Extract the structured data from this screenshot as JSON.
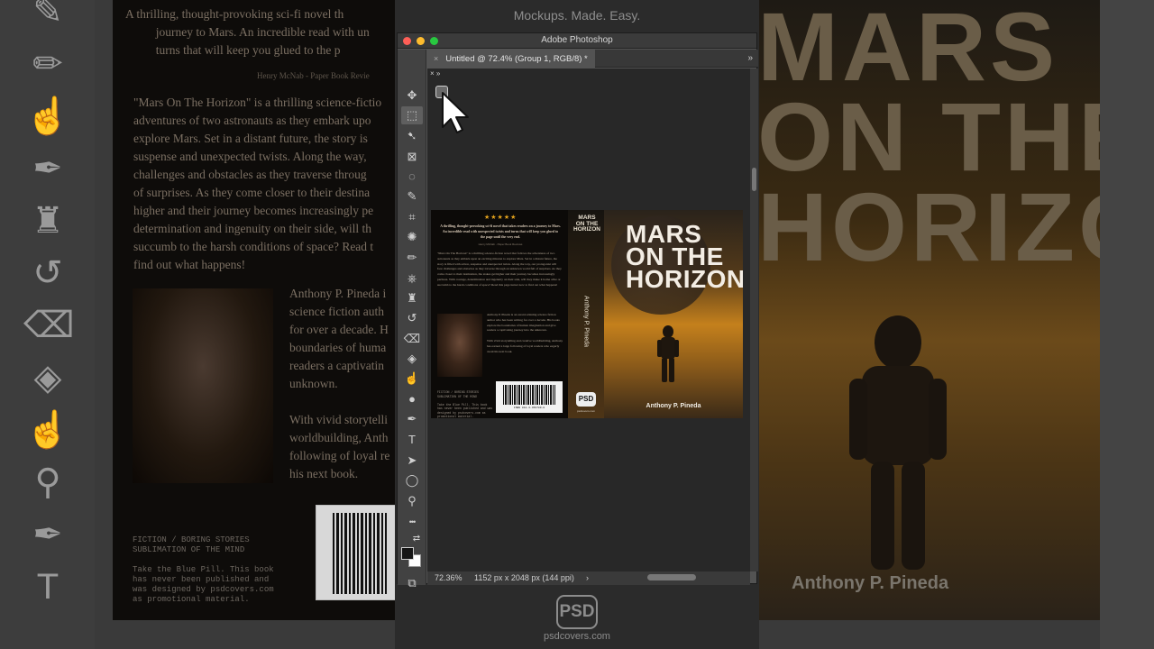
{
  "background": {
    "left": {
      "quote": "A thrilling, thought-provoking sci-fi novel th\n          journey to Mars. An incredible read with un\n          turns that will keep you glued to the p",
      "quote_attr": "Henry McNab - Paper Book Revie",
      "blurb": "\"Mars On The Horizon\" is a thrilling science-fictio\nadventures of two astronauts as they embark upo\nexplore Mars. Set in a distant future, the story is\nsuspense and unexpected twists. Along the way,\nchallenges and obstacles as they traverse throug\nof surprises. As they come closer to their destina\nhigher and their journey becomes increasingly pe\ndetermination and ingenuity on their side, will th\nsuccumb to the harsh conditions of space? Read t\nfind out what happens!",
      "author_bio": "Anthony P. Pineda i\nscience fiction auth\nfor over a decade. H\nboundaries of huma\nreaders a captivatin\nunknown.\n\nWith vivid storytelli\nworldbuilding, Anth\nfollowing of loyal re\nhis next book.",
      "genre": "FICTION / BORING STORIES\nSUBLIMATION OF THE MIND\n\nTake the Blue Pill. This book\nhas never been published and\nwas designed by psdcovers.com\nas promotional material."
    },
    "right": {
      "title": "MARS\nON THE\nHORIZON",
      "author": "Anthony P. Pineda"
    }
  },
  "center": {
    "tagline": "Mockups. Made. Easy.",
    "footer_logo": "PSD",
    "footer_url": "psdcovers.com"
  },
  "window": {
    "title": "Adobe Photoshop",
    "tab_label": "Untitled @ 72.4% (Group 1, RGB/8) *",
    "tab_close": "×",
    "collapse": "»",
    "panel_controls": "× »",
    "status": {
      "zoom": "72.36%",
      "dimensions": "1152 px x 2048 px (144 ppi)",
      "arrow": "›"
    }
  },
  "book": {
    "stars": "★★★★★",
    "quote": "A thrilling, thought-provoking sci-fi novel that takes readers on a journey to Mars. An incredible read with unexpected twists and turns that will keep you glued to the page until the very end.",
    "quote_attr": "Henry McNab - Paper Book Reviews",
    "blurb": "\"Mars On The Horizon\" is a thrilling science-fiction novel that follows the adventures of two astronauts as they embark upon an exciting mission to explore Mars. Set in a distant future, the story is filled with action, suspense and unexpected twists. Along the way, our protagonist will face challenges and obstacles as they traverse through an unknown world full of surprises. As they come closer to their destination, the stakes get higher and their journey becomes increasingly perilous. With courage, determination and ingenuity on their side, will they make it home alive or succumb to the harsh conditions of space? Read this page turner now to find out what happens!",
    "author_bio": "Anthony P. Pineda is an award-winning science fiction author who has been writing for over a decade. His books explore the boundaries of human imagination and give readers a captivating journey into the unknown.\n\nWith vivid storytelling and creative worldbuilding, Anthony has earned a large following of loyal readers who eagerly await his next book.",
    "genre": "FICTION / BORING STORIES SUBLIMATION OF THE MIND\n\nTake the Blue Pill. This book has never been published and was designed by psdcovers.com as promotional material.",
    "isbn": "ISBN 012-3-456789-0",
    "spine_title": "MARS\nON THE\nHORIZON",
    "spine_author": "Anthony P. Pineda",
    "spine_logo": "PSD",
    "spine_url": "psdcovers.com",
    "front_title": "MARS\nON THE\nHORIZON",
    "front_author": "Anthony P. Pineda"
  },
  "tools": [
    {
      "name": "move-tool-icon",
      "glyph": "✥"
    },
    {
      "name": "marquee-tool-icon",
      "glyph": "⬚"
    },
    {
      "name": "lasso-tool-icon",
      "glyph": "➷"
    },
    {
      "name": "frame-tool-icon",
      "glyph": "⊠"
    },
    {
      "name": "quick-select-tool-icon",
      "glyph": "◌"
    },
    {
      "name": "eyedropper-tool-icon",
      "glyph": "✎"
    },
    {
      "name": "crop-tool-icon",
      "glyph": "⌗"
    },
    {
      "name": "patch-tool-icon",
      "glyph": "✺"
    },
    {
      "name": "brush-tool-icon",
      "glyph": "✏"
    },
    {
      "name": "clone-stamp-tool-icon",
      "glyph": "⎈"
    },
    {
      "name": "stamp-tool-icon",
      "glyph": "♜"
    },
    {
      "name": "history-brush-tool-icon",
      "glyph": "↺"
    },
    {
      "name": "eraser-tool-icon",
      "glyph": "⌫"
    },
    {
      "name": "paint-bucket-tool-icon",
      "glyph": "◈"
    },
    {
      "name": "smudge-tool-icon",
      "glyph": "☝"
    },
    {
      "name": "dodge-tool-icon",
      "glyph": "●"
    },
    {
      "name": "pen-tool-icon",
      "glyph": "✒"
    },
    {
      "name": "type-tool-icon",
      "glyph": "T"
    },
    {
      "name": "path-select-tool-icon",
      "glyph": "➤"
    },
    {
      "name": "ellipse-tool-icon",
      "glyph": "◯"
    },
    {
      "name": "zoom-tool-icon",
      "glyph": "⚲"
    },
    {
      "name": "more-tools-icon",
      "glyph": "•••"
    },
    {
      "name": "reset-colors-icon",
      "glyph": "⇄"
    },
    {
      "name": "screen-mode-icon",
      "glyph": "⧉"
    }
  ],
  "bg_tools": [
    {
      "name": "bg-magic-wand-icon",
      "glyph": "✎"
    },
    {
      "name": "bg-brush-icon",
      "glyph": "✏"
    },
    {
      "name": "bg-hand-icon",
      "glyph": "☝"
    },
    {
      "name": "bg-eyedropper-icon",
      "glyph": "✒"
    },
    {
      "name": "bg-stamp-icon",
      "glyph": "♜"
    },
    {
      "name": "bg-history-icon",
      "glyph": "↺"
    },
    {
      "name": "bg-eraser-icon",
      "glyph": "⌫"
    },
    {
      "name": "bg-bucket-icon",
      "glyph": "◈"
    },
    {
      "name": "bg-smudge-icon",
      "glyph": "☝"
    },
    {
      "name": "bg-dodge-icon",
      "glyph": "⚲"
    },
    {
      "name": "bg-pen-icon",
      "glyph": "✒"
    },
    {
      "name": "bg-type-icon",
      "glyph": "T"
    }
  ]
}
